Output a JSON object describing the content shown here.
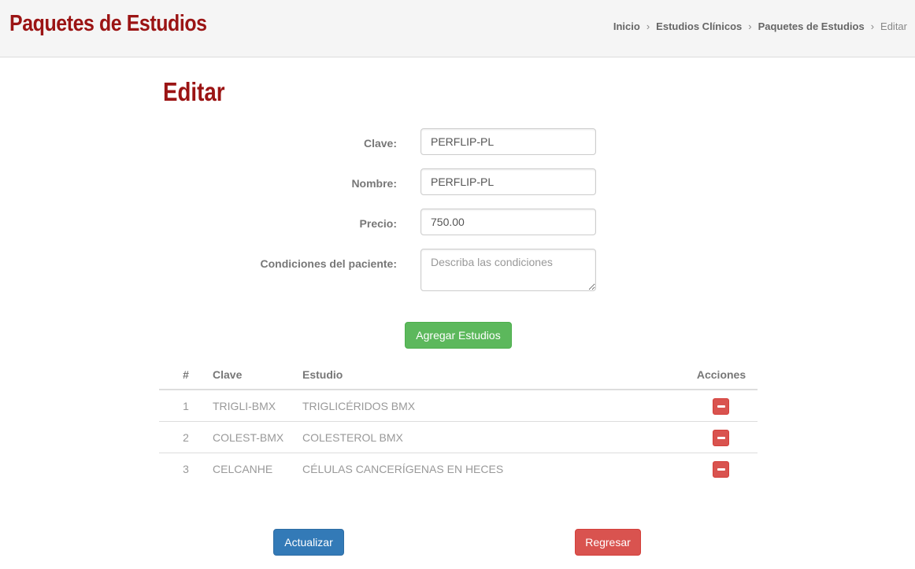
{
  "header": {
    "app_title": "Paquetes de Estudios",
    "breadcrumb": [
      {
        "label": "Inicio"
      },
      {
        "label": "Estudios Clínicos"
      },
      {
        "label": "Paquetes de Estudios"
      },
      {
        "label": "Editar"
      }
    ],
    "separator": "›"
  },
  "page": {
    "title": "Editar"
  },
  "form": {
    "clave": {
      "label": "Clave:",
      "value": "PERFLIP-PL"
    },
    "nombre": {
      "label": "Nombre:",
      "value": "PERFLIP-PL"
    },
    "precio": {
      "label": "Precio:",
      "value": "750.00"
    },
    "condiciones": {
      "label": "Condiciones del paciente:",
      "value": "",
      "placeholder": "Describa las condiciones"
    }
  },
  "add_button": {
    "label": "Agregar Estudios"
  },
  "table": {
    "columns": [
      "#",
      "Clave",
      "Estudio",
      "Acciones"
    ],
    "rows": [
      {
        "num": "1",
        "clave": "TRIGLI-BMX",
        "estudio": "TRIGLICÉRIDOS BMX",
        "action_icon": "minus-icon"
      },
      {
        "num": "2",
        "clave": "COLEST-BMX",
        "estudio": "COLESTEROL BMX",
        "action_icon": "minus-icon"
      },
      {
        "num": "3",
        "clave": "CELCANHE",
        "estudio": "CÉLULAS CANCERÍGENAS EN HECES",
        "action_icon": "minus-icon"
      }
    ]
  },
  "actions": {
    "update_label": "Actualizar",
    "back_label": "Regresar"
  },
  "colors": {
    "brand": "#9b1414",
    "success": "#5cb85c",
    "primary": "#337ab7",
    "danger": "#d9534f"
  }
}
